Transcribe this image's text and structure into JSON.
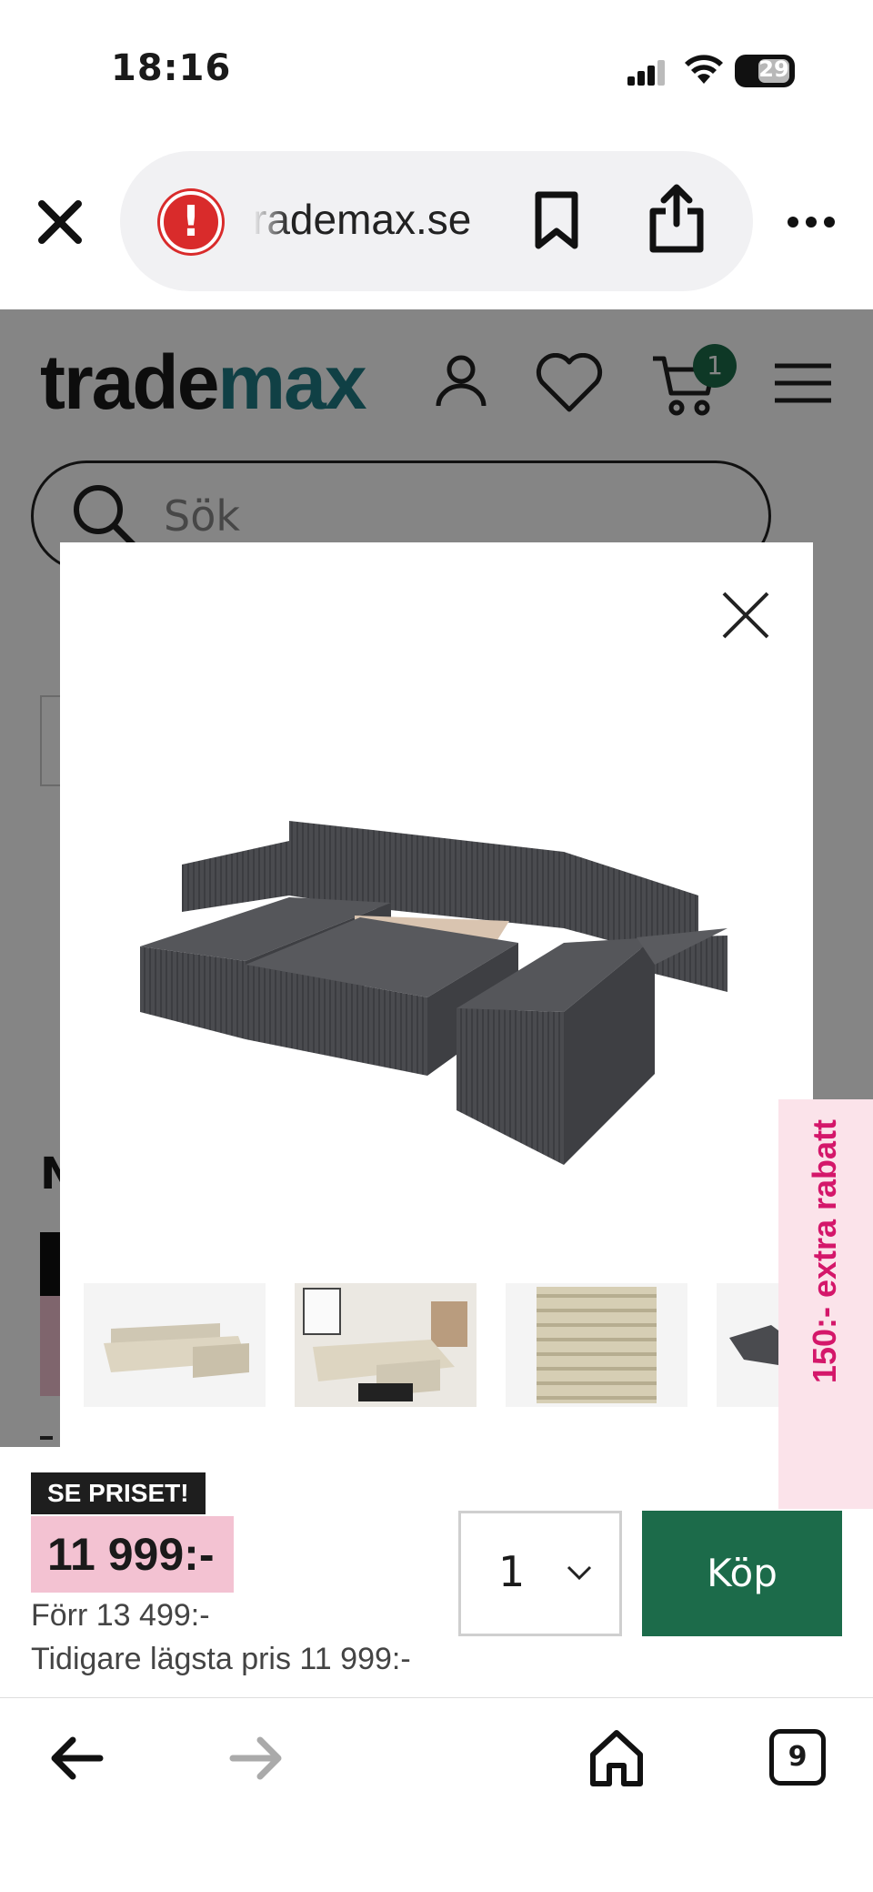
{
  "status_bar": {
    "time": "18:16",
    "battery": "29"
  },
  "browser": {
    "url": "rademax.se",
    "tab_count": "9"
  },
  "site": {
    "logo_part1": "trade",
    "logo_part2": "max",
    "cart_count": "1",
    "search_placeholder": "Sök",
    "peek_heading_letter": "N",
    "colors": {
      "brand_teal": "#1f7b85",
      "brand_green": "#1c6b4a",
      "price_pink": "#f3c2d2",
      "promo_magenta": "#d4176a"
    }
  },
  "buybar": {
    "badge": "SE PRISET!",
    "price": "11 999:-",
    "previous_price": "Förr 13 499:-",
    "lowest_price": "Tidigare lägsta pris 11 999:-",
    "quantity": "1",
    "buy_label": "Köp"
  },
  "promo": {
    "label": "150:- extra rabatt"
  },
  "modal": {
    "thumbnails": [
      "sofa-beige-thumb",
      "sofa-room-thumb",
      "fabric-closeup-thumb",
      "sofa-grey-thumb"
    ]
  }
}
